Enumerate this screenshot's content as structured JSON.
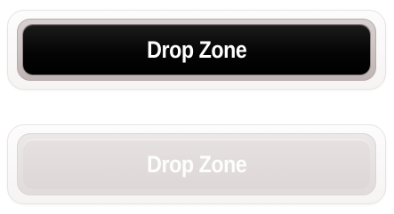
{
  "drop_zones": [
    {
      "label": "Drop Zone",
      "state": "active"
    },
    {
      "label": "Drop Zone",
      "state": "disabled"
    }
  ],
  "colors": {
    "active_face": "#000000",
    "active_text": "#ffffff",
    "disabled_face": "#e2dcdc",
    "disabled_text": "#ffffff"
  }
}
